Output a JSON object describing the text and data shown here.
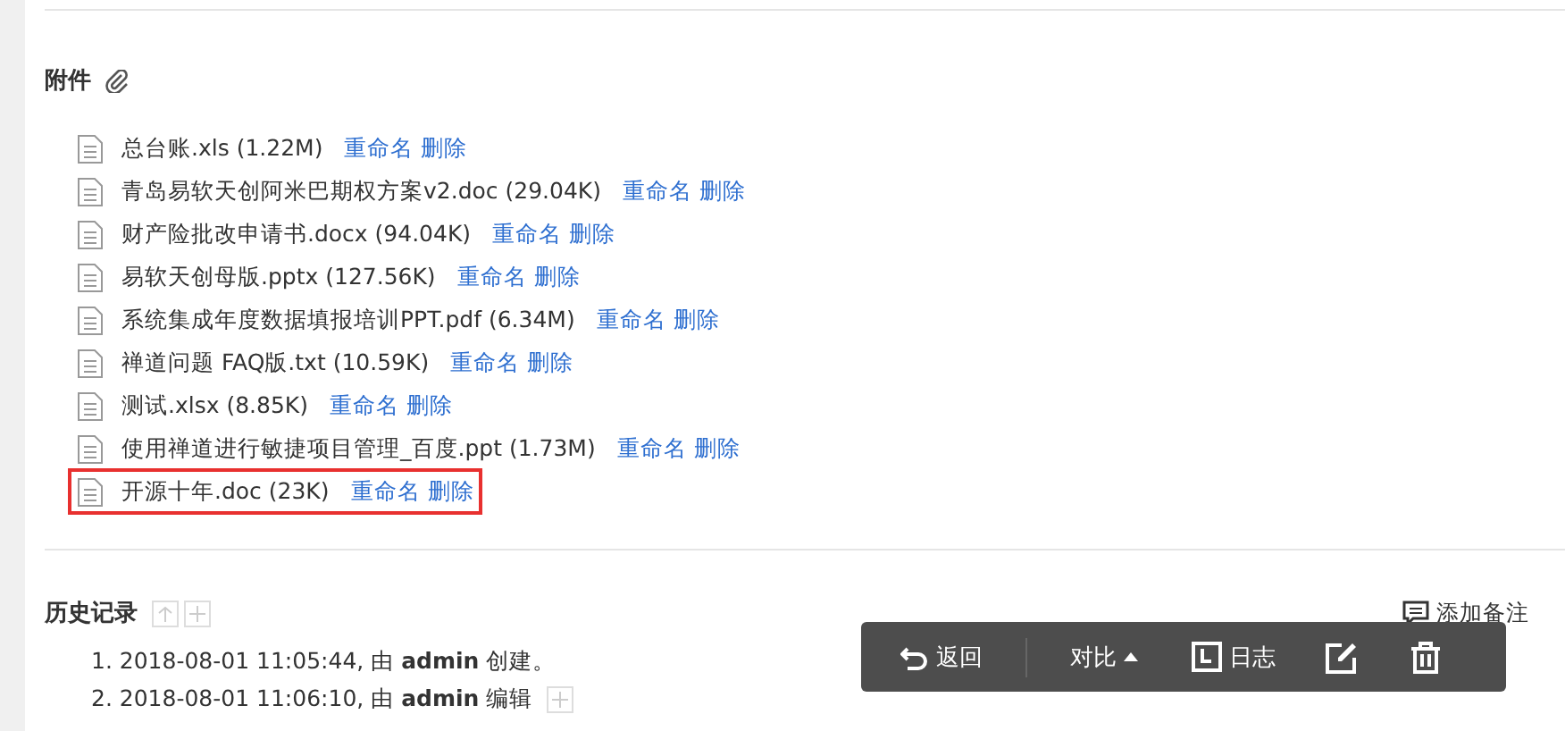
{
  "attachments": {
    "title": "附件",
    "files": [
      {
        "name": "总台账.xls (1.22M)",
        "rename": "重命名",
        "delete": "删除",
        "highlighted": false
      },
      {
        "name": "青岛易软天创阿米巴期权方案v2.doc (29.04K)",
        "rename": "重命名",
        "delete": "删除",
        "highlighted": false
      },
      {
        "name": "财产险批改申请书.docx (94.04K)",
        "rename": "重命名",
        "delete": "删除",
        "highlighted": false
      },
      {
        "name": "易软天创母版.pptx (127.56K)",
        "rename": "重命名",
        "delete": "删除",
        "highlighted": false
      },
      {
        "name": "系统集成年度数据填报培训PPT.pdf (6.34M)",
        "rename": "重命名",
        "delete": "删除",
        "highlighted": false
      },
      {
        "name": "禅道问题 FAQ版.txt (10.59K)",
        "rename": "重命名",
        "delete": "删除",
        "highlighted": false
      },
      {
        "name": "测试.xlsx (8.85K)",
        "rename": "重命名",
        "delete": "删除",
        "highlighted": false
      },
      {
        "name": "使用禅道进行敏捷项目管理_百度.ppt (1.73M)",
        "rename": "重命名",
        "delete": "删除",
        "highlighted": false
      },
      {
        "name": "开源十年.doc (23K)",
        "rename": "重命名",
        "delete": "删除",
        "highlighted": true
      }
    ]
  },
  "history": {
    "title": "历史记录",
    "add_note": "添加备注",
    "entries": [
      {
        "text": "1. 2018-08-01 11:05:44, 由 **admin** 创建。",
        "expandable": false
      },
      {
        "text": "2. 2018-08-01 11:06:10, 由 **admin** 编辑",
        "expandable": true
      }
    ]
  },
  "toolbar": [
    {
      "kind": "back",
      "label": "返回"
    },
    {
      "kind": "compare",
      "label": "对比"
    },
    {
      "kind": "log",
      "label": "日志"
    },
    {
      "kind": "edit"
    },
    {
      "kind": "delete"
    }
  ]
}
